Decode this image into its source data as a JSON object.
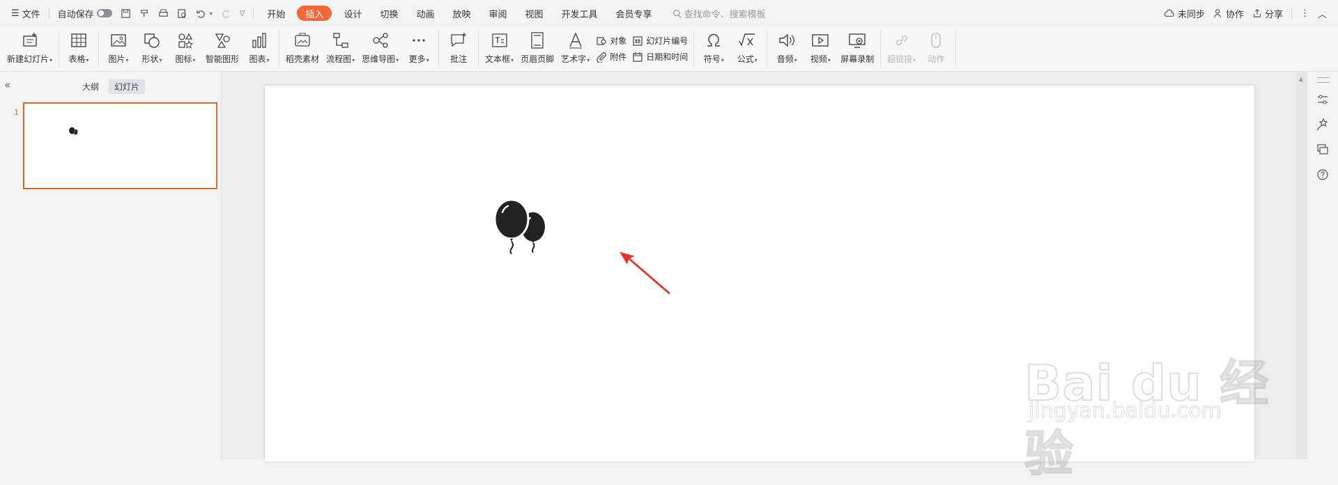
{
  "menubar": {
    "file": "文件",
    "autosave": "自动保存",
    "tabs": [
      {
        "label": "开始",
        "active": false
      },
      {
        "label": "插入",
        "active": true
      },
      {
        "label": "设计",
        "active": false
      },
      {
        "label": "切换",
        "active": false
      },
      {
        "label": "动画",
        "active": false
      },
      {
        "label": "放映",
        "active": false
      },
      {
        "label": "审阅",
        "active": false
      },
      {
        "label": "视图",
        "active": false
      },
      {
        "label": "开发工具",
        "active": false
      },
      {
        "label": "会员专享",
        "active": false
      }
    ],
    "search_placeholder": "查找命令、搜索模板",
    "right": {
      "sync": "未同步",
      "collab": "协作",
      "share": "分享"
    }
  },
  "ribbon": {
    "new_slide": "新建幻灯片",
    "table": "表格",
    "picture": "图片",
    "shape": "形状",
    "icon": "图标",
    "smartart": "智能图形",
    "chart": "图表",
    "material": "稻壳素材",
    "flowchart": "流程图",
    "mindmap": "思维导图",
    "more": "更多",
    "comment": "批注",
    "textbox": "文本框",
    "header_footer": "页眉页脚",
    "wordart": "艺术字",
    "object": "对象",
    "attachment": "附件",
    "slide_number": "幻灯片编号",
    "datetime": "日期和时间",
    "symbol": "符号",
    "formula": "公式",
    "audio": "音频",
    "video": "视频",
    "screen_record": "屏幕录制",
    "hyperlink": "超链接",
    "action": "动作"
  },
  "left_panel": {
    "outline_tab": "大纲",
    "slides_tab": "幻灯片",
    "slide_number": "1"
  },
  "colors": {
    "accent": "#f3683a",
    "selection": "#d9682e",
    "arrow": "#e8332a"
  },
  "slide": {
    "content_icon": "balloons-icon"
  },
  "watermark": {
    "brand": "Bai du 经验",
    "url": "jingyan.baidu.com"
  }
}
